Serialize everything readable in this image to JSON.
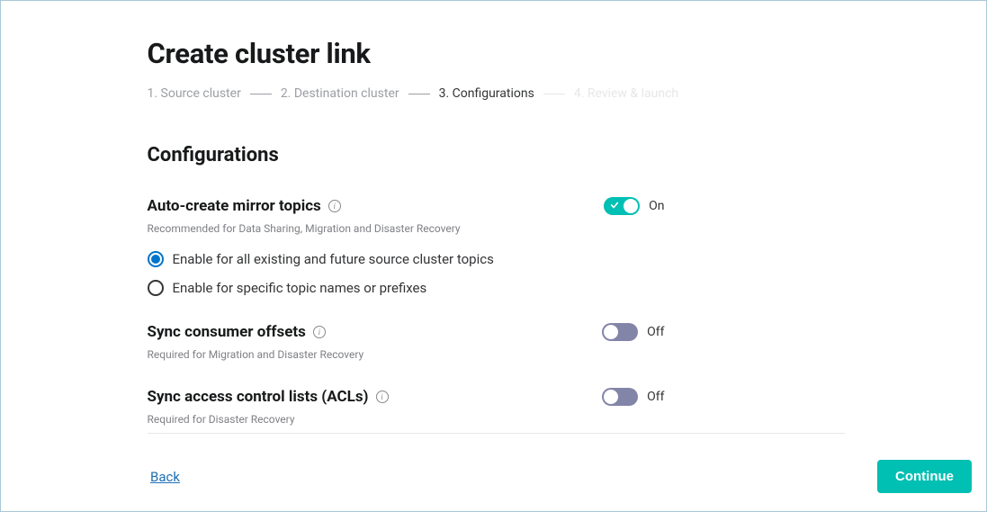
{
  "header": {
    "title": "Create cluster link"
  },
  "wizard": {
    "steps": [
      {
        "label": "1. Source cluster"
      },
      {
        "label": "2. Destination cluster"
      },
      {
        "label": "3. Configurations"
      },
      {
        "label": "4. Review & launch"
      }
    ],
    "activeIndex": 2
  },
  "section": {
    "title": "Configurations"
  },
  "configs": {
    "autoCreate": {
      "title": "Auto-create mirror topics",
      "subtitle": "Recommended for Data Sharing, Migration and Disaster Recovery",
      "toggle": {
        "on": true,
        "label": "On"
      },
      "radios": [
        {
          "label": "Enable for all existing and future source cluster topics",
          "selected": true
        },
        {
          "label": "Enable for specific topic names or prefixes",
          "selected": false
        }
      ]
    },
    "syncOffsets": {
      "title": "Sync consumer offsets",
      "subtitle": "Required for Migration and Disaster Recovery",
      "toggle": {
        "on": false,
        "label": "Off"
      }
    },
    "syncAcls": {
      "title": "Sync access control lists (ACLs)",
      "subtitle": "Required for Disaster Recovery",
      "toggle": {
        "on": false,
        "label": "Off"
      }
    }
  },
  "footer": {
    "back": "Back",
    "continue": "Continue"
  }
}
